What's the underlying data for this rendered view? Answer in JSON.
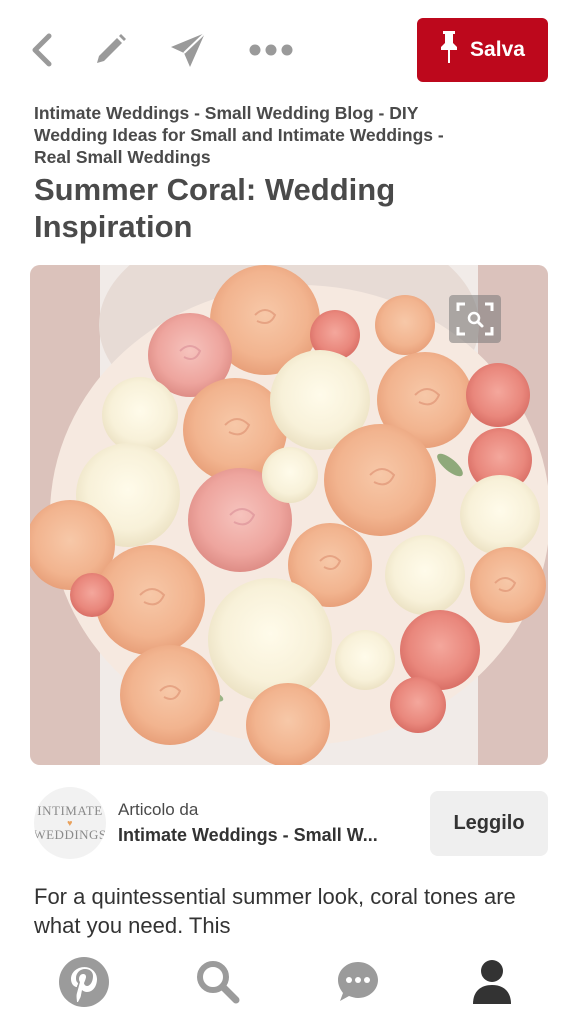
{
  "toolbar": {
    "back_icon": "chevron-left-icon",
    "edit_icon": "pencil-icon",
    "send_icon": "paper-plane-icon",
    "more_icon": "ellipsis-icon",
    "save_label": "Salva",
    "save_color": "#bd081c"
  },
  "pin": {
    "source_text": "Intimate Weddings - Small Wedding Blog - DIY Wedding Ideas for Small and Intimate Weddings - Real Small Weddings",
    "title": "Summer Coral: Wedding Inspiration",
    "image": {
      "description_icon": "visual-search-icon"
    }
  },
  "article": {
    "logo_line1": "INTIMATE",
    "logo_line2": "WEDDINGS",
    "label": "Articolo da",
    "source": "Intimate Weddings - Small W...",
    "read_label": "Leggilo"
  },
  "description": "For a quintessential summer look, coral tones are what you need. This",
  "bottom_nav": {
    "home_icon": "pinterest-icon",
    "search_icon": "search-icon",
    "chat_icon": "chat-bubble-icon",
    "profile_icon": "person-icon"
  }
}
